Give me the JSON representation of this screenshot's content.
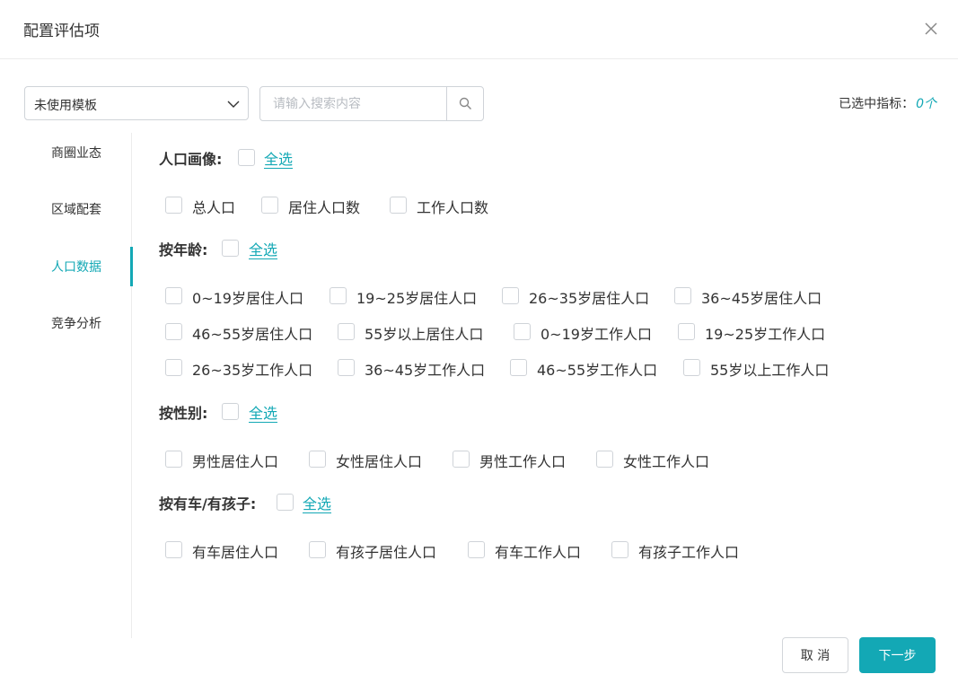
{
  "dialog": {
    "title": "配置评估项"
  },
  "template_select": {
    "value": "未使用模板"
  },
  "search": {
    "placeholder": "请输入搜索内容"
  },
  "selected_indicators": {
    "label": "已选中指标：",
    "count": "0个"
  },
  "sidebar": {
    "items": [
      {
        "label": "商圈业态",
        "active": false
      },
      {
        "label": "区域配套",
        "active": false
      },
      {
        "label": "人口数据",
        "active": true
      },
      {
        "label": "竞争分析",
        "active": false
      }
    ]
  },
  "groups": [
    {
      "title": "人口画像:",
      "select_all": "全选",
      "options": [
        "总人口",
        "居住人口数",
        "工作人口数"
      ]
    },
    {
      "title": "按年龄:",
      "select_all": "全选",
      "options": [
        "0~19岁居住人口",
        "19~25岁居住人口",
        "26~35岁居住人口",
        "36~45岁居住人口",
        "46~55岁居住人口",
        "55岁以上居住人口",
        "0~19岁工作人口",
        "19~25岁工作人口",
        "26~35岁工作人口",
        "36~45岁工作人口",
        "46~55岁工作人口",
        "55岁以上工作人口"
      ]
    },
    {
      "title": "按性别:",
      "select_all": "全选",
      "options": [
        "男性居住人口",
        "女性居住人口",
        "男性工作人口",
        "女性工作人口"
      ]
    },
    {
      "title": "按有车/有孩子:",
      "select_all": "全选",
      "options": [
        "有车居住人口",
        "有孩子居住人口",
        "有车工作人口",
        "有孩子工作人口"
      ]
    }
  ],
  "footer": {
    "cancel_label": "取 消",
    "next_label": "下一步"
  },
  "colors": {
    "accent": "#13a8b5",
    "border": "#cfd3d8",
    "text": "#333333"
  },
  "icons": {
    "close": "close-icon",
    "dropdown": "chevron-down-icon",
    "search": "search-icon"
  }
}
